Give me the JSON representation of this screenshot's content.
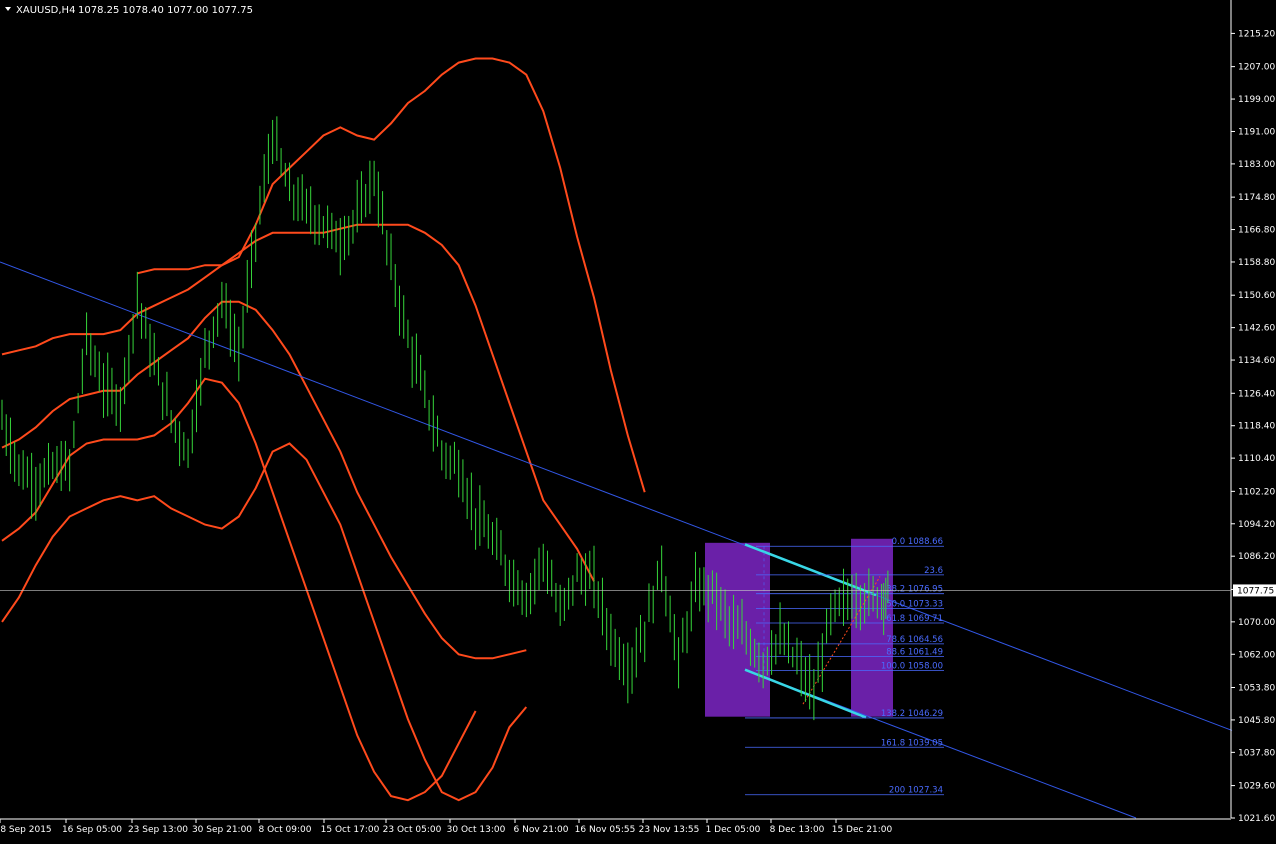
{
  "header": {
    "symbol": "XAUUSD,H4",
    "ohlc": "1078.25 1078.40 1077.00 1077.75"
  },
  "colors": {
    "background": "#000000",
    "axis": "#ffffff",
    "candle": "#36d63b",
    "envelope": "#ff4a1c",
    "trendline": "#3257e6",
    "fib": "#4a6bff",
    "channel": "#39d7e6",
    "zone": "#6a20a8",
    "price_line": "#c8c8c8"
  },
  "chart_data": {
    "type": "line",
    "ylim": [
      1021.6,
      1219.0
    ],
    "y_ticks": [
      "1215.20",
      "1207.00",
      "1199.00",
      "1191.00",
      "1183.00",
      "1174.80",
      "1166.80",
      "1158.80",
      "1150.60",
      "1142.60",
      "1134.60",
      "1126.40",
      "1118.40",
      "1110.40",
      "1102.20",
      "1094.20",
      "1086.20",
      "1078.00",
      "1070.00",
      "1062.00",
      "1053.80",
      "1045.80",
      "1037.80",
      "1029.60",
      "1021.60"
    ],
    "x_ticks": [
      "8 Sep 2015",
      "16 Sep 05:00",
      "23 Sep 13:00",
      "30 Sep 21:00",
      "8 Oct 09:00",
      "15 Oct 17:00",
      "23 Oct 05:00",
      "30 Oct 13:00",
      "6 Nov 21:00",
      "16 Nov 05:55",
      "23 Nov 13:55",
      "1 Dec 05:00",
      "8 Dec 13:00",
      "15 Dec 21:00"
    ],
    "current_price": "1077.75",
    "price_series": {
      "name": "XAUUSD H4",
      "x": [
        0,
        4,
        8,
        12,
        16,
        20,
        24,
        28,
        32,
        36,
        40,
        44,
        48,
        52,
        56,
        60,
        64,
        68,
        72,
        76,
        80,
        84,
        88,
        92,
        96,
        100,
        104,
        108,
        112,
        116,
        120,
        124,
        128,
        132,
        136,
        140,
        144,
        148,
        152,
        156,
        160,
        164,
        168,
        172,
        176,
        180,
        184,
        188,
        192,
        196,
        200,
        204,
        208,
        210
      ],
      "y": [
        1120,
        1108,
        1104,
        1108,
        1108,
        1140,
        1128,
        1124,
        1150,
        1134,
        1120,
        1112,
        1136,
        1150,
        1136,
        1166,
        1190,
        1176,
        1172,
        1168,
        1164,
        1170,
        1180,
        1158,
        1140,
        1126,
        1112,
        1108,
        1096,
        1090,
        1082,
        1076,
        1086,
        1072,
        1082,
        1080,
        1066,
        1058,
        1068,
        1084,
        1060,
        1078,
        1078,
        1070,
        1066,
        1060,
        1066,
        1060,
        1052,
        1072,
        1076,
        1076,
        1076,
        1077.75
      ]
    },
    "envelopes": {
      "x": [
        0,
        4,
        8,
        12,
        16,
        20,
        24,
        28,
        32,
        36,
        40,
        44,
        48,
        52,
        56,
        60,
        64,
        68,
        72,
        76,
        80,
        84,
        88,
        92,
        96,
        100,
        104,
        108,
        112,
        116,
        120,
        124,
        128,
        132,
        136,
        140,
        144,
        148,
        152,
        156,
        160,
        164,
        168,
        172,
        176,
        180,
        184,
        188,
        192,
        196,
        200,
        204,
        208,
        210
      ],
      "outer_upper": [
        null,
        null,
        null,
        null,
        null,
        null,
        null,
        null,
        1156,
        1157,
        1157,
        1157,
        1158,
        1158,
        1160,
        1168,
        1178,
        1182,
        1186,
        1190,
        1192,
        1190,
        1189,
        1193,
        1198,
        1201,
        1205,
        1208,
        1209,
        1209,
        1208,
        1205,
        1196,
        1182,
        1165,
        1150,
        1132,
        1116,
        1102,
        null,
        null,
        null,
        null,
        null,
        null,
        null,
        null,
        null,
        null,
        null,
        null,
        null,
        null,
        null
      ],
      "upper": [
        1136,
        1137,
        1138,
        1140,
        1141,
        1141,
        1141,
        1142,
        1146,
        1148,
        1150,
        1152,
        1155,
        1158,
        1161,
        1164,
        1166,
        1166,
        1166,
        1166,
        1167,
        1168,
        1168,
        1168,
        1168,
        1166,
        1163,
        1158,
        1148,
        1136,
        1124,
        1112,
        1100,
        1094,
        1088,
        1080,
        null,
        null,
        null,
        null,
        null,
        null,
        null,
        null,
        null,
        null,
        null,
        null,
        null,
        null,
        null,
        null,
        null,
        null
      ],
      "middle": [
        1113,
        1115,
        1118,
        1122,
        1125,
        1126,
        1127,
        1127,
        1131,
        1134,
        1137,
        1140,
        1145,
        1149,
        1149,
        1147,
        1142,
        1136,
        1128,
        1120,
        1112,
        1102,
        1094,
        1086,
        1079,
        1072,
        1066,
        1062,
        1061,
        1061,
        1062,
        1063,
        null,
        null,
        null,
        null,
        null,
        null,
        null,
        null,
        null,
        null,
        null,
        null,
        null,
        null,
        null,
        null,
        null,
        null,
        null,
        null,
        null,
        null
      ],
      "lower": [
        1090,
        1093,
        1097,
        1104,
        1111,
        1114,
        1115,
        1115,
        1115,
        1116,
        1119,
        1124,
        1130,
        1129,
        1124,
        1114,
        1102,
        1090,
        1078,
        1066,
        1054,
        1042,
        1033,
        1027,
        1026,
        1028,
        1032,
        1040,
        1048,
        null,
        null,
        null,
        null,
        null,
        null,
        null,
        null,
        null,
        null,
        null,
        null,
        null,
        null,
        null,
        null,
        null,
        null,
        null,
        null,
        null,
        null,
        null,
        null,
        null
      ],
      "outer_lower": [
        1070,
        1076,
        1084,
        1091,
        1096,
        1098,
        1100,
        1101,
        1100,
        1101,
        1098,
        1096,
        1094,
        1093,
        1096,
        1103,
        1112,
        1114,
        1110,
        1102,
        1094,
        1082,
        1070,
        1058,
        1046,
        1036,
        1028,
        1026,
        1028,
        1034,
        1044,
        1049,
        null,
        null,
        null,
        null,
        null,
        null,
        null,
        null,
        null,
        null,
        null,
        null,
        null,
        null,
        null,
        null,
        null,
        null,
        null,
        null,
        null,
        null
      ]
    },
    "fib_levels": [
      {
        "ratio": "0.0",
        "price": "1088.66"
      },
      {
        "ratio": "23.6",
        "price": ""
      },
      {
        "ratio": "38.2",
        "price": "1076.95"
      },
      {
        "ratio": "50.0",
        "price": "1073.33"
      },
      {
        "ratio": "61.8",
        "price": "1069.71"
      },
      {
        "ratio": "78.6",
        "price": "1064.56"
      },
      {
        "ratio": "88.6",
        "price": "1061.49"
      },
      {
        "ratio": "100.0",
        "price": "1058.00"
      },
      {
        "ratio": "138.2",
        "price": "1046.29"
      },
      {
        "ratio": "161.8",
        "price": "1039.05"
      },
      {
        "ratio": "200",
        "price": "1027.34"
      }
    ],
    "grid": false
  }
}
